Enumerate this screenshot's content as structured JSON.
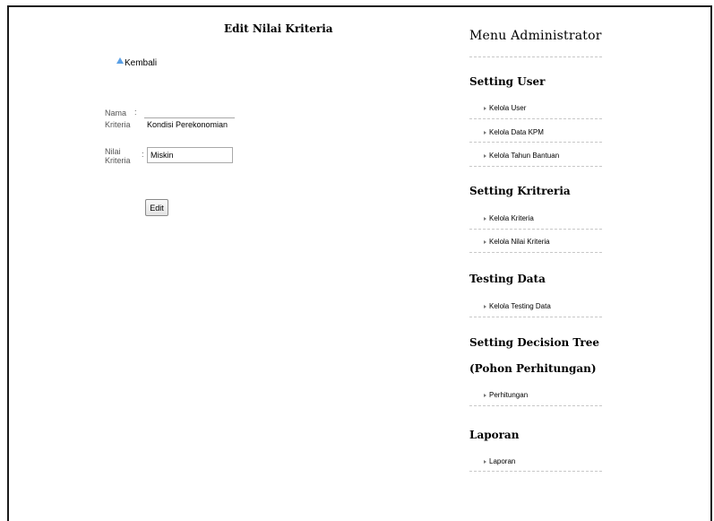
{
  "form": {
    "title": "Edit Nilai Kriteria",
    "back_label": "Kembali",
    "nama_label_1": "Nama",
    "nama_label_2": "Kriteria",
    "nama_value": "Kondisi Perekonomian",
    "nilai_label_1": "Nilai",
    "nilai_label_2": "Kriteria",
    "nilai_value": "Miskin",
    "colon": ":",
    "edit_label": "Edit"
  },
  "menu": {
    "title": "Menu Administrator",
    "sections": [
      {
        "heading": "Setting User",
        "items": [
          "Kelola User",
          "Kelola Data KPM",
          "Kelola Tahun Bantuan"
        ]
      },
      {
        "heading": "Setting Kritreria",
        "items": [
          "Kelola Kriteria",
          "Kelola Nilai Kriteria"
        ]
      },
      {
        "heading": "Testing Data",
        "items": [
          "Kelola Testing Data"
        ]
      },
      {
        "heading": "Setting Decision Tree",
        "heading2": "(Pohon Perhitungan)",
        "items": [
          "Perhitungan"
        ]
      },
      {
        "heading": "Laporan",
        "items": [
          "Laporan"
        ]
      }
    ]
  }
}
